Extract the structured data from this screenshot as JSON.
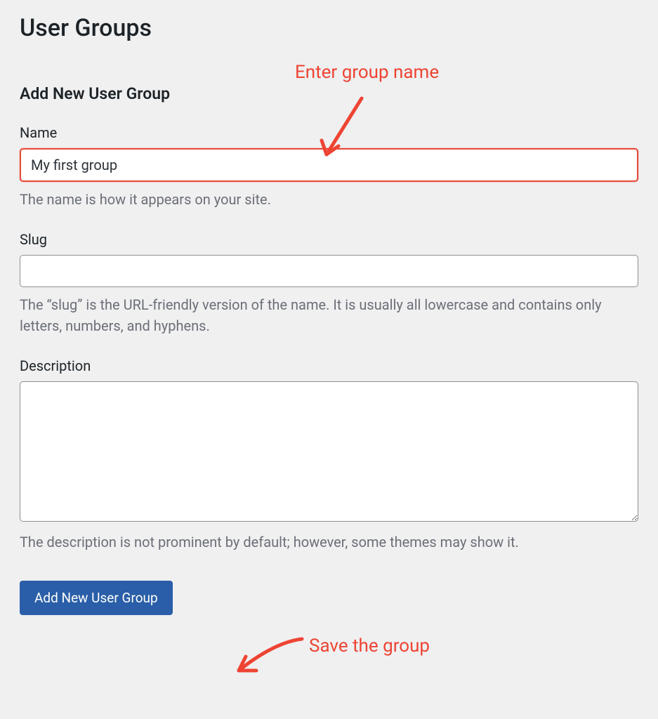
{
  "page": {
    "title": "User Groups"
  },
  "form": {
    "heading": "Add New User Group",
    "name": {
      "label": "Name",
      "value": "My first group",
      "help": "The name is how it appears on your site."
    },
    "slug": {
      "label": "Slug",
      "value": "",
      "help": "The “slug” is the URL-friendly version of the name. It is usually all lowercase and contains only letters, numbers, and hyphens."
    },
    "description": {
      "label": "Description",
      "value": "",
      "help": "The description is not prominent by default; however, some themes may show it."
    },
    "submit_label": "Add New User Group"
  },
  "annotations": {
    "enter_name": "Enter group name",
    "save_group": "Save the group"
  }
}
